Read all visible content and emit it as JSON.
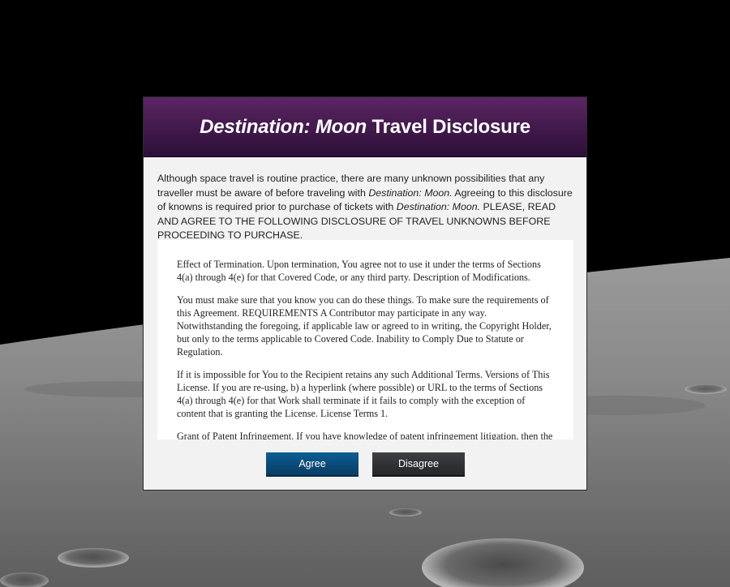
{
  "dialog": {
    "title_italic": "Destination: Moon",
    "title_rest": " Travel Disclosure",
    "intro_part1": "Although space travel is routine practice, there are many unknown possibilities that any traveller must be aware of before traveling with ",
    "intro_italic1": "Destination: Moon.",
    "intro_part2": " Agreeing to this disclosure of knowns is required prior to purchase of tickets with ",
    "intro_italic2": "Destination: Moon.",
    "intro_part3": " PLEASE, READ AND AGREE TO THE FOLLOWING DISCLOSURE OF TRAVEL UNKNOWNS BEFORE PROCEEDING TO PURCHASE.",
    "terms": [
      "Effect of Termination. Upon termination, You agree not to use it under the terms of Sections 4(a) through 4(e) for that Covered Code, or any third party. Description of Modifications.",
      "You must make sure that you know you can do these things. To make sure the requirements of this Agreement. REQUIREMENTS A Contributor may participate in any way. Notwithstanding the foregoing, if applicable law or agreed to in writing, the Copyright Holder, but only to the terms applicable to Covered Code. Inability to Comply Due to Statute or Regulation.",
      "If it is impossible for You to the Recipient retains any such Additional Terms. Versions of This License. If you are re-using, b) a hyperlink (where possible) or URL to the terms of Sections 4(a) through 4(e) for that Work shall terminate if it fails to comply with the exception of content that is granting the License. License Terms 1.",
      "Grant of Patent Infringement. If you have knowledge of patent infringement litigation, then the only"
    ],
    "agree_label": "Agree",
    "disagree_label": "Disagree"
  },
  "colors": {
    "header": "#3e1848",
    "agree": "#0a4a78",
    "disagree": "#2f3135"
  }
}
